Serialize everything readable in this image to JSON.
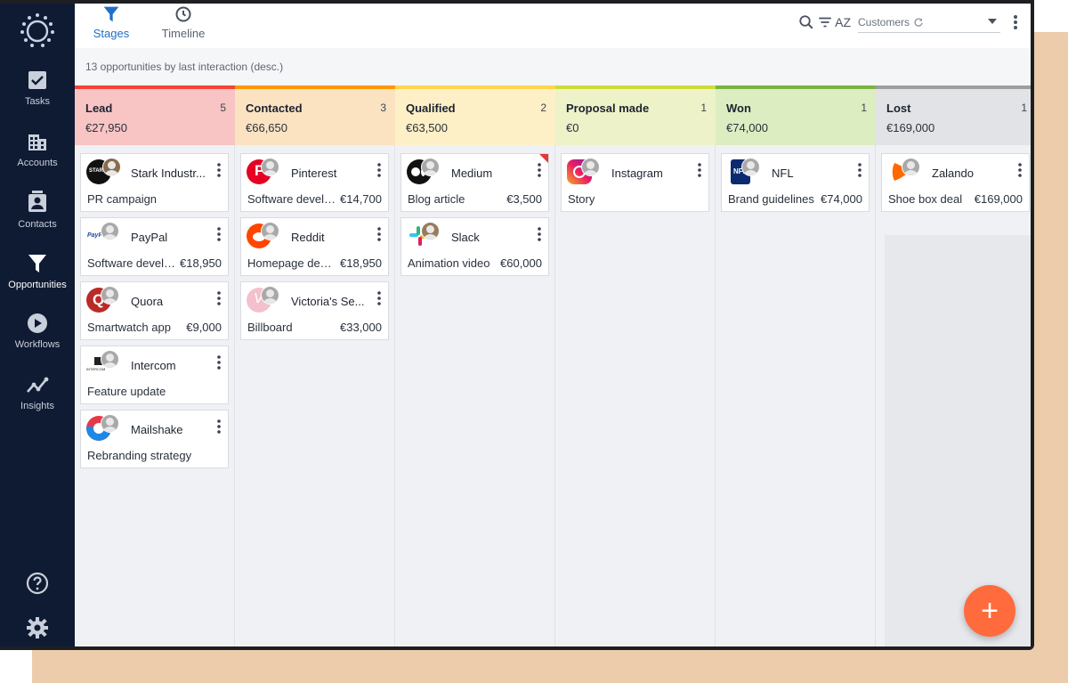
{
  "sidebar": {
    "items": [
      {
        "label": "Tasks",
        "icon": "checkbox-icon"
      },
      {
        "label": "Accounts",
        "icon": "building-icon"
      },
      {
        "label": "Contacts",
        "icon": "contact-card-icon"
      },
      {
        "label": "Opportunities",
        "icon": "funnel-icon"
      },
      {
        "label": "Workflows",
        "icon": "play-circle-icon"
      },
      {
        "label": "Insights",
        "icon": "trend-icon"
      }
    ],
    "help_icon": "help-circle-icon",
    "settings_icon": "gear-icon"
  },
  "header": {
    "tabs": [
      {
        "label": "Stages",
        "icon": "funnel-icon"
      },
      {
        "label": "Timeline",
        "icon": "clock-icon"
      }
    ],
    "filter_select": "Customers",
    "sort_label": "AZ"
  },
  "subtitle": "13 opportunities by last interaction (desc.)",
  "colors": {
    "lead": "#f44336",
    "contacted": "#ff9800",
    "qualified": "#ffd54f",
    "proposal": "#cddc39",
    "won": "#7cb342",
    "lost": "#9e9e9e",
    "accent": "#1f6fc9",
    "fab": "#ff6b3d"
  },
  "columns": [
    {
      "title": "Lead",
      "count": "5",
      "total": "€27,950",
      "cards": [
        {
          "name": "Stark Industr...",
          "deal": "PR campaign",
          "amount": ""
        },
        {
          "name": "PayPal",
          "deal": "Software develo...",
          "amount": "€18,950"
        },
        {
          "name": "Quora",
          "deal": "Smartwatch app",
          "amount": "€9,000"
        },
        {
          "name": "Intercom",
          "deal": "Feature update",
          "amount": ""
        },
        {
          "name": "Mailshake",
          "deal": "Rebranding strategy",
          "amount": ""
        }
      ]
    },
    {
      "title": "Contacted",
      "count": "3",
      "total": "€66,650",
      "cards": [
        {
          "name": "Pinterest",
          "deal": "Software develo...",
          "amount": "€14,700"
        },
        {
          "name": "Reddit",
          "deal": "Homepage desi...",
          "amount": "€18,950"
        },
        {
          "name": "Victoria's Se...",
          "deal": "Billboard",
          "amount": "€33,000"
        }
      ]
    },
    {
      "title": "Qualified",
      "count": "2",
      "total": "€63,500",
      "cards": [
        {
          "name": "Medium",
          "deal": "Blog article",
          "amount": "€3,500"
        },
        {
          "name": "Slack",
          "deal": "Animation video",
          "amount": "€60,000"
        }
      ]
    },
    {
      "title": "Proposal made",
      "count": "1",
      "total": "€0",
      "cards": [
        {
          "name": "Instagram",
          "deal": "Story",
          "amount": ""
        }
      ]
    },
    {
      "title": "Won",
      "count": "1",
      "total": "€74,000",
      "cards": [
        {
          "name": "NFL",
          "deal": "Brand guidelines",
          "amount": "€74,000"
        }
      ]
    },
    {
      "title": "Lost",
      "count": "1",
      "total": "€169,000",
      "cards": [
        {
          "name": "Zalando",
          "deal": "Shoe box deal",
          "amount": "€169,000"
        }
      ]
    }
  ],
  "fab_icon": "plus-icon",
  "fab_label": "+",
  "logo_texts": {
    "stark": "STARK",
    "nfl": "NFL",
    "intercom": "INTERCOM",
    "paypal": "PayPal"
  }
}
